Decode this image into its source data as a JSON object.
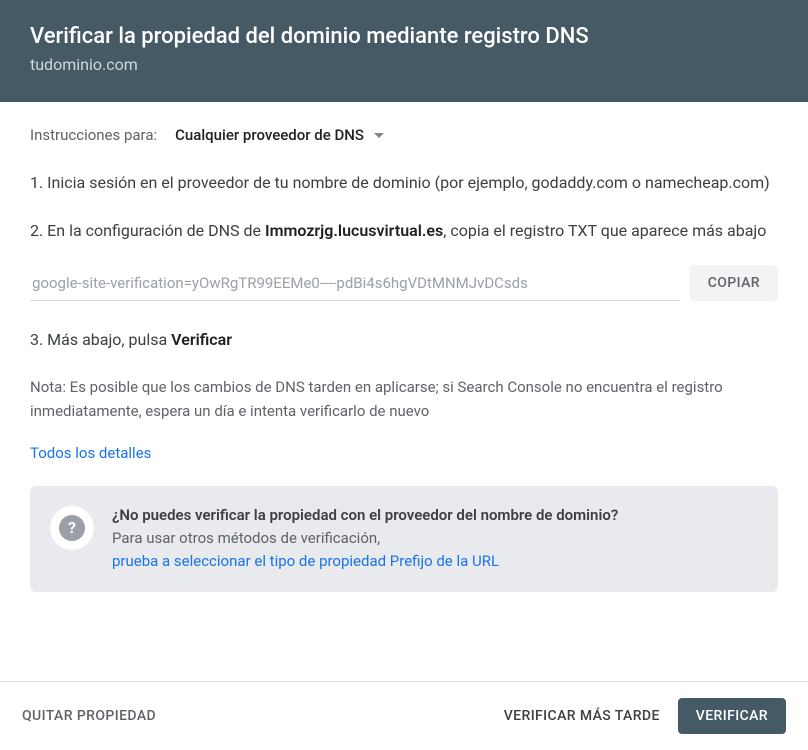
{
  "header": {
    "title": "Verificar la propiedad del dominio mediante registro DNS",
    "subtitle": "tudominio.com"
  },
  "instructions": {
    "label": "Instrucciones para:",
    "providerDropdown": "Cualquier proveedor de DNS"
  },
  "steps": {
    "step1": "1. Inicia sesión en el proveedor de tu nombre de dominio (por ejemplo, godaddy.com o namecheap.com)",
    "step2_prefix": "2. En la configuración de DNS de ",
    "step2_bold": "Immozrjg.lucusvirtual.es",
    "step2_suffix": ", copia el registro TXT que aparece más abajo",
    "step3_prefix": "3. Más abajo, pulsa ",
    "step3_bold": "Verificar"
  },
  "txtRecord": {
    "value": "google-site-verification=yOwRgTR99EEMe0----pdBi4s6hgVDtMNMJvDCsds",
    "copyLabel": "COPIAR"
  },
  "note": "Nota: Es posible que los cambios de DNS tarden en aplicarse; si Search Console no encuentra el registro inmediatamente, espera un día e intenta verificarlo de nuevo",
  "detailsLink": "Todos los detalles",
  "infoBox": {
    "title": "¿No puedes verificar la propiedad con el proveedor del nombre de dominio?",
    "body": "Para usar otros métodos de verificación,",
    "link": "prueba a seleccionar el tipo de propiedad Prefijo de la URL"
  },
  "footer": {
    "removeProperty": "QUITAR PROPIEDAD",
    "verifyLater": "VERIFICAR MÁS TARDE",
    "verify": "VERIFICAR"
  }
}
